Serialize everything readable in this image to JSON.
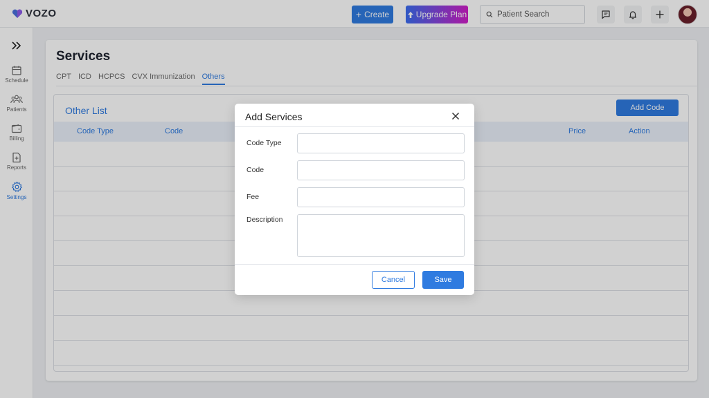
{
  "app": {
    "logo_text": "VOZO"
  },
  "topbar": {
    "create_label": "Create",
    "upgrade_label": "Upgrade Plan",
    "search_placeholder": "Patient Search"
  },
  "sidebar": {
    "items": [
      {
        "label": "Schedule",
        "icon": "calendar-icon"
      },
      {
        "label": "Patients",
        "icon": "users-icon"
      },
      {
        "label": "Billing",
        "icon": "wallet-icon"
      },
      {
        "label": "Reports",
        "icon": "report-icon"
      },
      {
        "label": "Settings",
        "icon": "gear-icon",
        "active": true
      }
    ]
  },
  "page": {
    "title": "Services",
    "tabs": [
      {
        "label": "CPT"
      },
      {
        "label": "ICD"
      },
      {
        "label": "HCPCS"
      },
      {
        "label": "CVX Immunization"
      },
      {
        "label": "Others",
        "active": true
      }
    ],
    "list_title": "Other List",
    "add_code_label": "Add Code",
    "columns": [
      "Code Type",
      "Code",
      "Price",
      "Action"
    ]
  },
  "modal": {
    "title": "Add Services",
    "fields": [
      {
        "label": "Code Type",
        "value": ""
      },
      {
        "label": "Code",
        "value": ""
      },
      {
        "label": "Fee",
        "value": ""
      },
      {
        "label": "Description",
        "value": ""
      }
    ],
    "cancel_label": "Cancel",
    "save_label": "Save"
  },
  "colors": {
    "accent": "#2f7be0",
    "upgrade_start": "#3a6df0",
    "upgrade_end": "#d01ec8"
  }
}
